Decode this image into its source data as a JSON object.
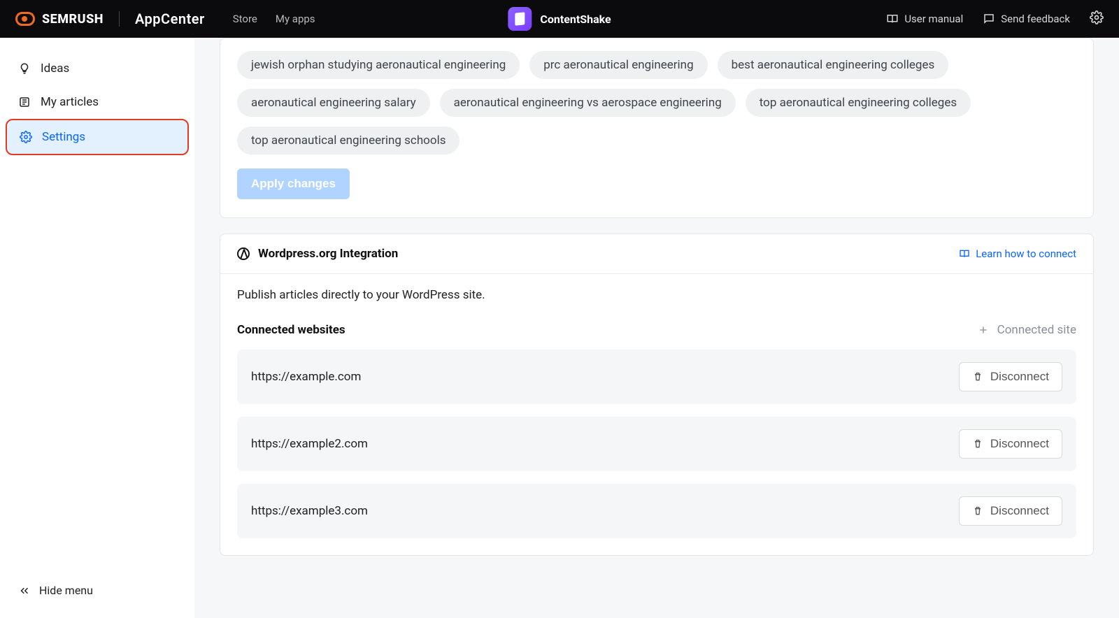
{
  "header": {
    "brand": "SEMRUSH",
    "appcenter": "AppCenter",
    "nav": {
      "store": "Store",
      "my_apps": "My apps"
    },
    "app_name": "ContentShake",
    "user_manual": "User manual",
    "send_feedback": "Send feedback"
  },
  "sidebar": {
    "ideas": "Ideas",
    "my_articles": "My articles",
    "settings": "Settings",
    "hide_menu": "Hide menu"
  },
  "tags": [
    "jewish orphan studying aeronautical engineering",
    "prc aeronautical engineering",
    "best aeronautical engineering colleges",
    "aeronautical engineering salary",
    "aeronautical engineering vs aerospace engineering",
    "top aeronautical engineering colleges",
    "top aeronautical engineering schools"
  ],
  "apply_changes": "Apply changes",
  "wordpress": {
    "title": "Wordpress.org Integration",
    "learn_link": "Learn how to connect",
    "description": "Publish articles directly to your WordPress site.",
    "connected_label": "Connected websites",
    "add_site": "Connected site",
    "disconnect_label": "Disconnect",
    "sites": [
      "https://example.com",
      "https://example2.com",
      "https://example3.com"
    ]
  }
}
